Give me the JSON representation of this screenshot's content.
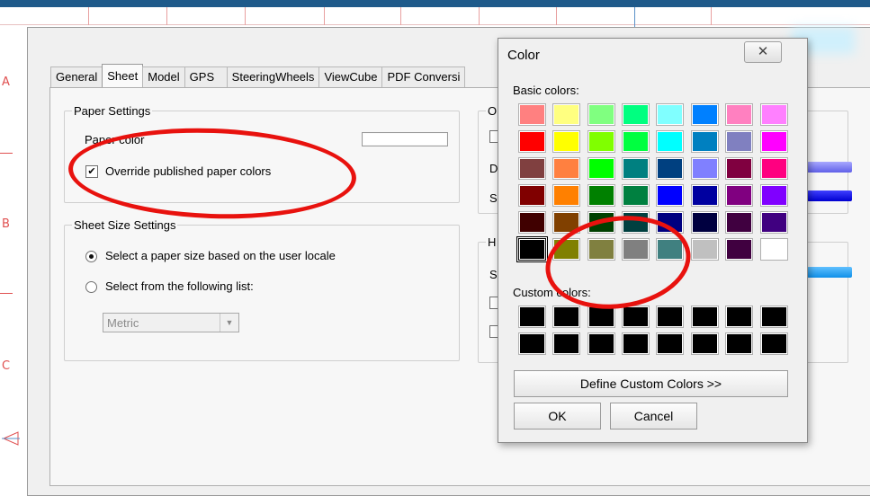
{
  "options_dialog": {
    "tabs": [
      {
        "label": "General"
      },
      {
        "label": "Sheet"
      },
      {
        "label": "Model"
      },
      {
        "label": "GPS"
      },
      {
        "label": "SteeringWheels"
      },
      {
        "label": "ViewCube"
      },
      {
        "label": "PDF Conversi"
      }
    ],
    "active_tab": "Sheet",
    "paper_settings": {
      "legend": "Paper Settings",
      "paper_color_label": "Paper color",
      "override_label": "Override published paper colors",
      "override_checked": true
    },
    "sheet_size_settings": {
      "legend": "Sheet Size Settings",
      "option_locale_label": "Select a paper size based on the user locale",
      "option_list_label": "Select from the following list:",
      "selected_option": "locale",
      "list_value": "Metric"
    },
    "right_groups": {
      "group1_legend": "O",
      "group2_legend": "H",
      "labels": [
        "D",
        "S",
        "S"
      ]
    }
  },
  "ruler_labels": [
    "A",
    "B",
    "C"
  ],
  "color_dialog": {
    "title": "Color",
    "close_icon": "close-x-icon",
    "basic_colors_label": "Basic colors:",
    "custom_colors_label": "Custom colors:",
    "define_custom_label": "Define Custom Colors >>",
    "ok_label": "OK",
    "cancel_label": "Cancel",
    "basic_colors": [
      [
        "#ff8080",
        "#ffff80",
        "#80ff80",
        "#00ff80",
        "#80ffff",
        "#0080ff",
        "#ff80c0",
        "#ff80ff"
      ],
      [
        "#ff0000",
        "#ffff00",
        "#80ff00",
        "#00ff40",
        "#00ffff",
        "#0080c0",
        "#8080c0",
        "#ff00ff"
      ],
      [
        "#804040",
        "#ff8040",
        "#00ff00",
        "#008080",
        "#004080",
        "#8080ff",
        "#800040",
        "#ff0080"
      ],
      [
        "#800000",
        "#ff8000",
        "#008000",
        "#008040",
        "#0000ff",
        "#0000a0",
        "#800080",
        "#8000ff"
      ],
      [
        "#400000",
        "#804000",
        "#004000",
        "#004040",
        "#000080",
        "#000040",
        "#400040",
        "#400080"
      ],
      [
        "#000000",
        "#808000",
        "#808040",
        "#808080",
        "#408080",
        "#c0c0c0",
        "#400040",
        "#ffffff"
      ]
    ],
    "selected_basic": "#000000",
    "custom_colors": [
      [
        "#000000",
        "#000000",
        "#000000",
        "#000000",
        "#000000",
        "#000000",
        "#000000",
        "#000000"
      ],
      [
        "#000000",
        "#000000",
        "#000000",
        "#000000",
        "#000000",
        "#000000",
        "#000000",
        "#000000"
      ]
    ]
  },
  "annotation_color": "#e8120e"
}
